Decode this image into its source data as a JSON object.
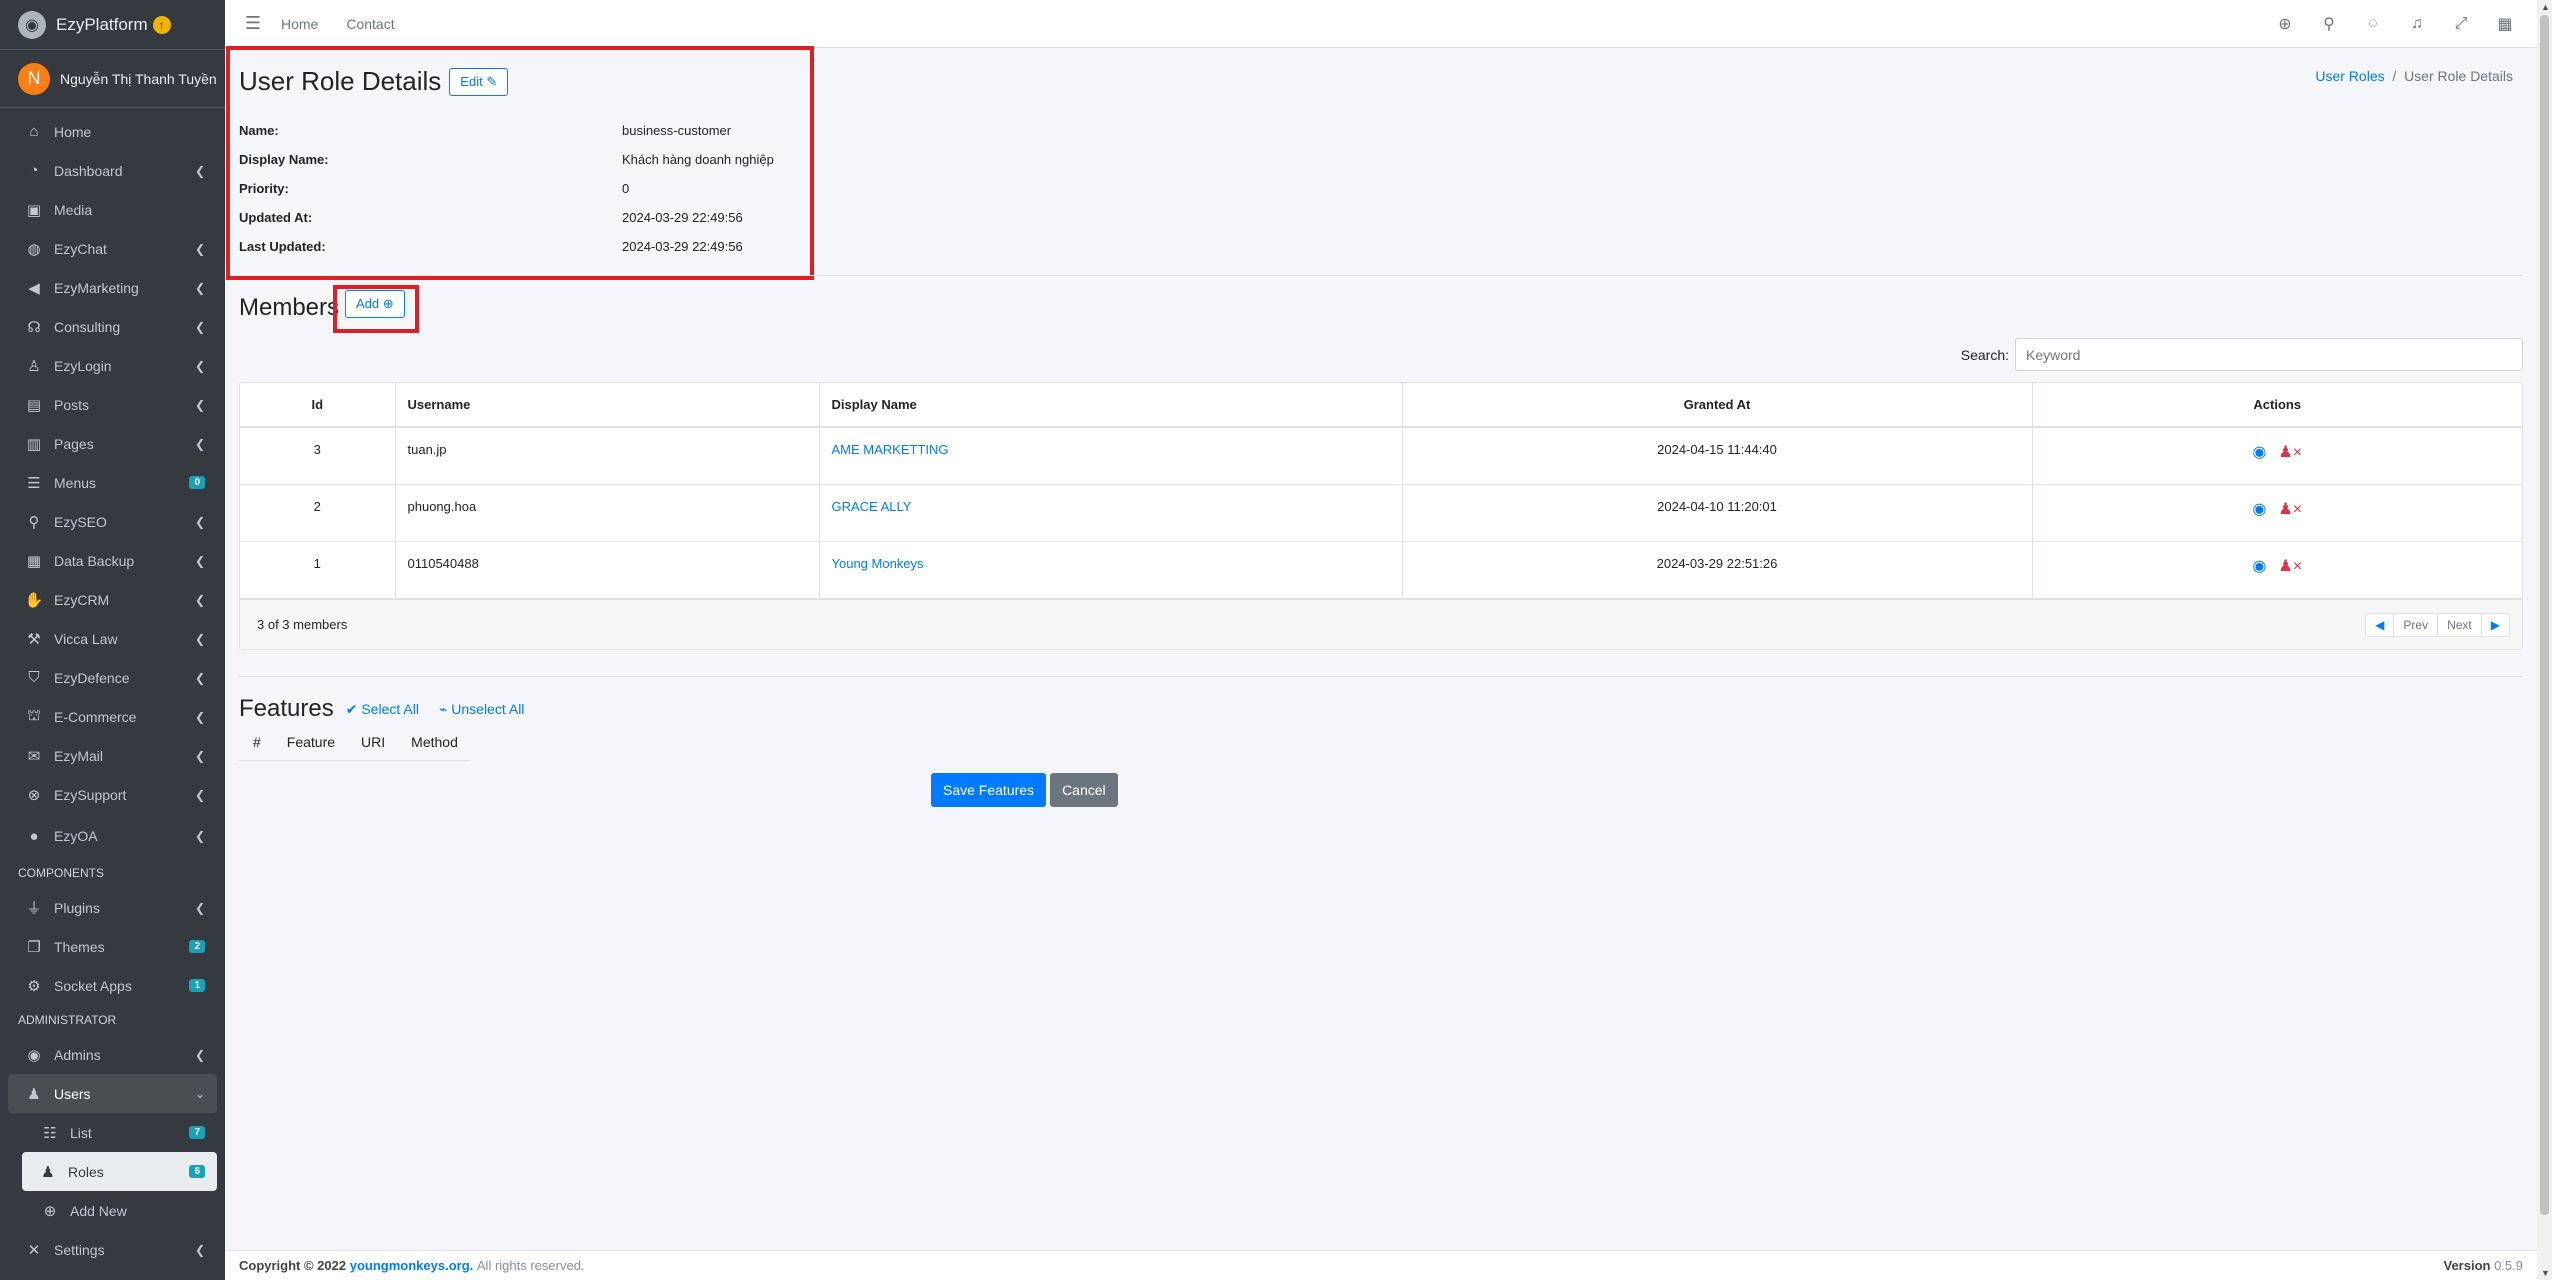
{
  "brand": {
    "name": "EzyPlatform"
  },
  "user": {
    "initial": "N",
    "name": "Nguyễn Thị Thanh Tuyền"
  },
  "sidebar": {
    "items": [
      {
        "label": "Home",
        "icon": "home-icon"
      },
      {
        "label": "Dashboard",
        "icon": "dashboard-icon"
      },
      {
        "label": "Media",
        "icon": "media-icon"
      },
      {
        "label": "EzyChat",
        "icon": "chat-icon"
      },
      {
        "label": "EzyMarketing",
        "icon": "megaphone-icon"
      },
      {
        "label": "Consulting",
        "icon": "headset-icon"
      },
      {
        "label": "EzyLogin",
        "icon": "user-lock-icon"
      },
      {
        "label": "Posts",
        "icon": "posts-icon"
      },
      {
        "label": "Pages",
        "icon": "pages-icon"
      },
      {
        "label": "Menus",
        "icon": "menu-icon",
        "badge": "0"
      },
      {
        "label": "EzySEO",
        "icon": "search-icon"
      },
      {
        "label": "Data Backup",
        "icon": "archive-icon"
      },
      {
        "label": "EzyCRM",
        "icon": "handshake-icon"
      },
      {
        "label": "Vicca Law",
        "icon": "gavel-icon"
      },
      {
        "label": "EzyDefence",
        "icon": "shield-icon"
      },
      {
        "label": "E-Commerce",
        "icon": "basket-icon"
      },
      {
        "label": "EzyMail",
        "icon": "mail-icon"
      },
      {
        "label": "EzySupport",
        "icon": "support-icon"
      },
      {
        "label": "EzyOA",
        "icon": "oa-icon"
      }
    ],
    "components_header": "COMPONENTS",
    "components": [
      {
        "label": "Plugins",
        "icon": "plug-icon"
      },
      {
        "label": "Themes",
        "icon": "themes-icon",
        "badge": "2"
      },
      {
        "label": "Socket Apps",
        "icon": "socket-icon",
        "badge": "1"
      }
    ],
    "admin_header": "ADMINISTRATOR",
    "admins": {
      "label": "Admins"
    },
    "users": {
      "label": "Users"
    },
    "list": {
      "label": "List",
      "badge": "7"
    },
    "roles": {
      "label": "Roles",
      "badge": "6"
    },
    "add_new": {
      "label": "Add New"
    },
    "settings": {
      "label": "Settings"
    }
  },
  "topbar": {
    "home": "Home",
    "contact": "Contact"
  },
  "page": {
    "title": "User Role Details",
    "edit_label": "Edit",
    "breadcrumb": {
      "parent": "User Roles",
      "current": "User Role Details"
    }
  },
  "details": [
    {
      "key": "Name:",
      "value": "business-customer"
    },
    {
      "key": "Display Name:",
      "value": "Khách hàng doanh nghiệp"
    },
    {
      "key": "Priority:",
      "value": "0"
    },
    {
      "key": "Updated At:",
      "value": "2024-03-29 22:49:56"
    },
    {
      "key": "Last Updated:",
      "value": "2024-03-29 22:49:56"
    }
  ],
  "members": {
    "title": "Members",
    "add_label": "Add",
    "search_label": "Search:",
    "search_placeholder": "Keyword",
    "columns": [
      "Id",
      "Username",
      "Display Name",
      "Granted At",
      "Actions"
    ],
    "rows": [
      {
        "id": "3",
        "username": "tuan.jp",
        "display_name": "AME MARKETTING",
        "granted_at": "2024-04-15 11:44:40"
      },
      {
        "id": "2",
        "username": "phuong.hoa",
        "display_name": "GRACE ALLY",
        "granted_at": "2024-04-10 11:20:01"
      },
      {
        "id": "1",
        "username": "0110540488",
        "display_name": "Young Monkeys",
        "granted_at": "2024-03-29 22:51:26"
      }
    ],
    "summary": "3 of 3 members",
    "prev": "Prev",
    "next": "Next"
  },
  "features": {
    "title": "Features",
    "select_all": "Select All",
    "unselect_all": "Unselect All",
    "columns": [
      "#",
      "Feature",
      "URI",
      "Method"
    ],
    "save_label": "Save Features",
    "cancel_label": "Cancel"
  },
  "footer": {
    "copyright": "Copyright © 2022",
    "link": "youngmonkeys.org.",
    "rights": "All rights reserved.",
    "version_label": "Version",
    "version": "0.5.9"
  },
  "colors": {
    "accent": "#007bff",
    "highlight": "#e01e26",
    "sidebar": "#343a40",
    "danger": "#dc3545"
  }
}
